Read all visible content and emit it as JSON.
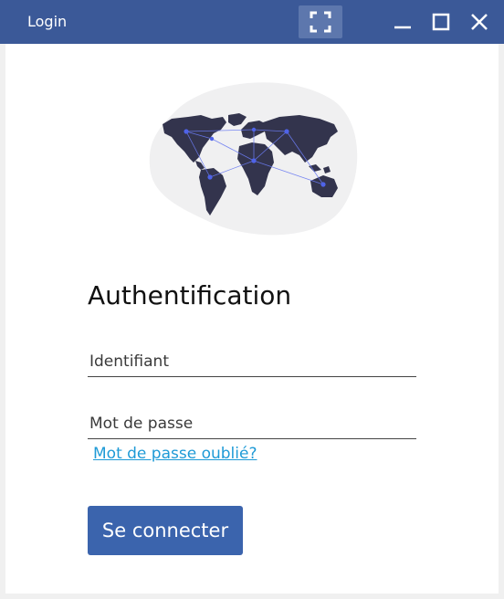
{
  "window": {
    "title": "Login",
    "controls": {
      "fullscreen": "fullscreen-icon",
      "minimize": "minimize-icon",
      "maximize": "maximize-icon",
      "close": "close-icon"
    },
    "titlebar_color": "#3b5998"
  },
  "form": {
    "heading": "Authentification",
    "username": {
      "placeholder": "Identifiant",
      "value": ""
    },
    "password": {
      "placeholder": "Mot de passe",
      "value": ""
    },
    "forgot_link": "Mot de passe oublié?",
    "submit_label": "Se connecter",
    "accent_color": "#3b64ad",
    "link_color": "#1e9ad6"
  },
  "illustration": {
    "icon": "world-map-network-icon"
  }
}
